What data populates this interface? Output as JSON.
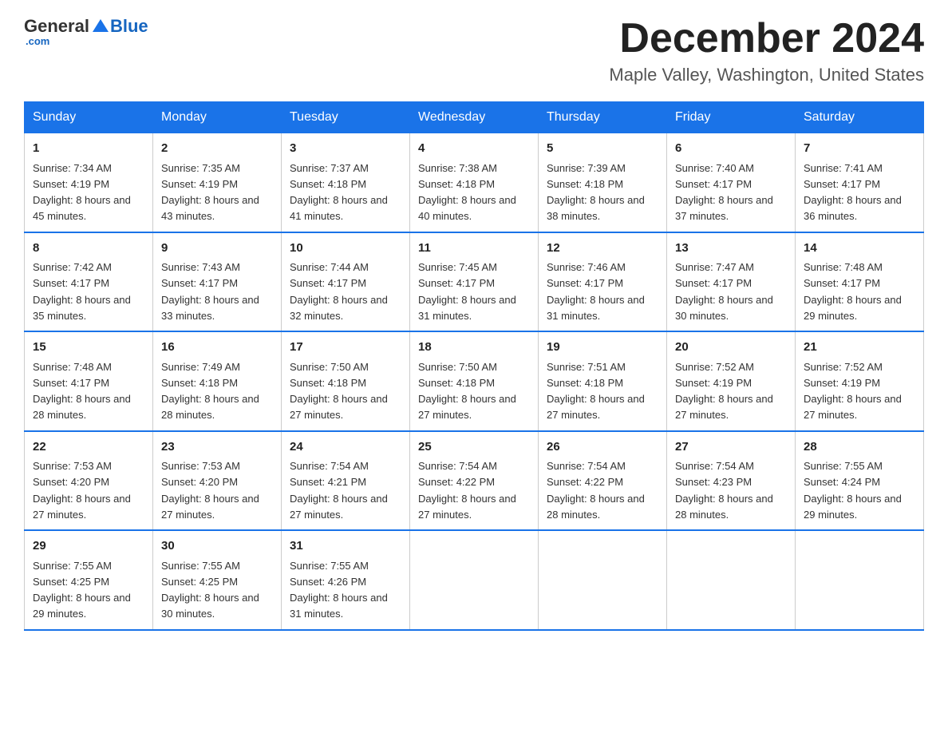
{
  "header": {
    "logo_general": "General",
    "logo_blue": "Blue",
    "month_title": "December 2024",
    "location": "Maple Valley, Washington, United States"
  },
  "days_of_week": [
    "Sunday",
    "Monday",
    "Tuesday",
    "Wednesday",
    "Thursday",
    "Friday",
    "Saturday"
  ],
  "weeks": [
    [
      {
        "day": "1",
        "sunrise": "7:34 AM",
        "sunset": "4:19 PM",
        "daylight": "8 hours and 45 minutes."
      },
      {
        "day": "2",
        "sunrise": "7:35 AM",
        "sunset": "4:19 PM",
        "daylight": "8 hours and 43 minutes."
      },
      {
        "day": "3",
        "sunrise": "7:37 AM",
        "sunset": "4:18 PM",
        "daylight": "8 hours and 41 minutes."
      },
      {
        "day": "4",
        "sunrise": "7:38 AM",
        "sunset": "4:18 PM",
        "daylight": "8 hours and 40 minutes."
      },
      {
        "day": "5",
        "sunrise": "7:39 AM",
        "sunset": "4:18 PM",
        "daylight": "8 hours and 38 minutes."
      },
      {
        "day": "6",
        "sunrise": "7:40 AM",
        "sunset": "4:17 PM",
        "daylight": "8 hours and 37 minutes."
      },
      {
        "day": "7",
        "sunrise": "7:41 AM",
        "sunset": "4:17 PM",
        "daylight": "8 hours and 36 minutes."
      }
    ],
    [
      {
        "day": "8",
        "sunrise": "7:42 AM",
        "sunset": "4:17 PM",
        "daylight": "8 hours and 35 minutes."
      },
      {
        "day": "9",
        "sunrise": "7:43 AM",
        "sunset": "4:17 PM",
        "daylight": "8 hours and 33 minutes."
      },
      {
        "day": "10",
        "sunrise": "7:44 AM",
        "sunset": "4:17 PM",
        "daylight": "8 hours and 32 minutes."
      },
      {
        "day": "11",
        "sunrise": "7:45 AM",
        "sunset": "4:17 PM",
        "daylight": "8 hours and 31 minutes."
      },
      {
        "day": "12",
        "sunrise": "7:46 AM",
        "sunset": "4:17 PM",
        "daylight": "8 hours and 31 minutes."
      },
      {
        "day": "13",
        "sunrise": "7:47 AM",
        "sunset": "4:17 PM",
        "daylight": "8 hours and 30 minutes."
      },
      {
        "day": "14",
        "sunrise": "7:48 AM",
        "sunset": "4:17 PM",
        "daylight": "8 hours and 29 minutes."
      }
    ],
    [
      {
        "day": "15",
        "sunrise": "7:48 AM",
        "sunset": "4:17 PM",
        "daylight": "8 hours and 28 minutes."
      },
      {
        "day": "16",
        "sunrise": "7:49 AM",
        "sunset": "4:18 PM",
        "daylight": "8 hours and 28 minutes."
      },
      {
        "day": "17",
        "sunrise": "7:50 AM",
        "sunset": "4:18 PM",
        "daylight": "8 hours and 27 minutes."
      },
      {
        "day": "18",
        "sunrise": "7:50 AM",
        "sunset": "4:18 PM",
        "daylight": "8 hours and 27 minutes."
      },
      {
        "day": "19",
        "sunrise": "7:51 AM",
        "sunset": "4:18 PM",
        "daylight": "8 hours and 27 minutes."
      },
      {
        "day": "20",
        "sunrise": "7:52 AM",
        "sunset": "4:19 PM",
        "daylight": "8 hours and 27 minutes."
      },
      {
        "day": "21",
        "sunrise": "7:52 AM",
        "sunset": "4:19 PM",
        "daylight": "8 hours and 27 minutes."
      }
    ],
    [
      {
        "day": "22",
        "sunrise": "7:53 AM",
        "sunset": "4:20 PM",
        "daylight": "8 hours and 27 minutes."
      },
      {
        "day": "23",
        "sunrise": "7:53 AM",
        "sunset": "4:20 PM",
        "daylight": "8 hours and 27 minutes."
      },
      {
        "day": "24",
        "sunrise": "7:54 AM",
        "sunset": "4:21 PM",
        "daylight": "8 hours and 27 minutes."
      },
      {
        "day": "25",
        "sunrise": "7:54 AM",
        "sunset": "4:22 PM",
        "daylight": "8 hours and 27 minutes."
      },
      {
        "day": "26",
        "sunrise": "7:54 AM",
        "sunset": "4:22 PM",
        "daylight": "8 hours and 28 minutes."
      },
      {
        "day": "27",
        "sunrise": "7:54 AM",
        "sunset": "4:23 PM",
        "daylight": "8 hours and 28 minutes."
      },
      {
        "day": "28",
        "sunrise": "7:55 AM",
        "sunset": "4:24 PM",
        "daylight": "8 hours and 29 minutes."
      }
    ],
    [
      {
        "day": "29",
        "sunrise": "7:55 AM",
        "sunset": "4:25 PM",
        "daylight": "8 hours and 29 minutes."
      },
      {
        "day": "30",
        "sunrise": "7:55 AM",
        "sunset": "4:25 PM",
        "daylight": "8 hours and 30 minutes."
      },
      {
        "day": "31",
        "sunrise": "7:55 AM",
        "sunset": "4:26 PM",
        "daylight": "8 hours and 31 minutes."
      },
      null,
      null,
      null,
      null
    ]
  ]
}
